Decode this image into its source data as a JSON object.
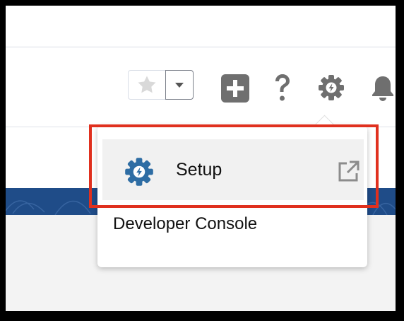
{
  "menu": {
    "items": [
      {
        "label": "Setup",
        "icon": "setup-gear-icon",
        "trailing_icon": "external-link-icon"
      },
      {
        "label": "Developer Console"
      }
    ]
  },
  "toolbar": {
    "icons": [
      "favorite-star-icon",
      "chevron-down-icon",
      "global-add-icon",
      "help-icon",
      "setup-gear-icon",
      "notifications-bell-icon"
    ]
  },
  "colors": {
    "highlight": "#e0301e",
    "setup_icon": "#2e6da4",
    "band": "#1f4c88",
    "toolbar_icon": "#6f6f6f"
  }
}
